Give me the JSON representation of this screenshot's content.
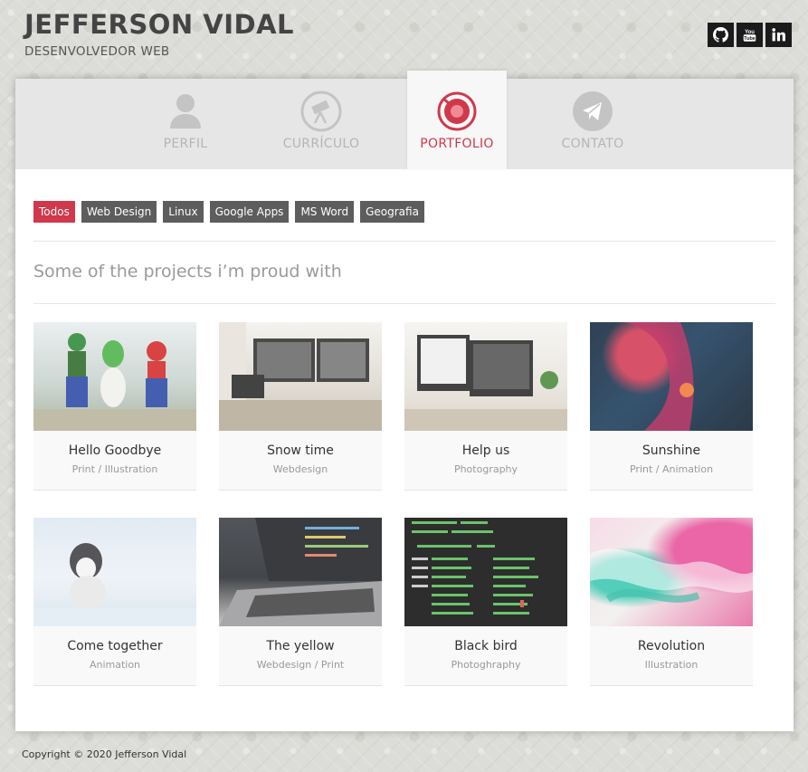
{
  "header": {
    "title": "JEFFERSON VIDAL",
    "subtitle": "DESENVOLVEDOR WEB",
    "social": [
      {
        "icon": "github-icon"
      },
      {
        "icon": "youtube-icon",
        "label": "You Tube"
      },
      {
        "icon": "linkedin-icon",
        "label": "in"
      }
    ]
  },
  "tabs": [
    {
      "label": "PERFIL",
      "icon": "user-icon",
      "active": false
    },
    {
      "label": "CURRÍCULO",
      "icon": "telescope-icon",
      "active": false
    },
    {
      "label": "PORTFOLIO",
      "icon": "target-icon",
      "active": true
    },
    {
      "label": "CONTATO",
      "icon": "paper-plane-icon",
      "active": false
    }
  ],
  "filters": [
    "Todos",
    "Web Design",
    "Linux",
    "Google Apps",
    "MS Word",
    "Geografia"
  ],
  "active_filter": "Todos",
  "section_heading": "Some of the projects i’m proud with",
  "projects": [
    {
      "title": "Hello Goodbye",
      "category": "Print / Illustration"
    },
    {
      "title": "Snow time",
      "category": "Webdesign"
    },
    {
      "title": "Help us",
      "category": "Photography"
    },
    {
      "title": "Sunshine",
      "category": "Print / Animation"
    },
    {
      "title": "Come together",
      "category": "Animation"
    },
    {
      "title": "The yellow",
      "category": "Webdesign / Print"
    },
    {
      "title": "Black bird",
      "category": "Photoghraphy"
    },
    {
      "title": "Revolution",
      "category": "Illustration"
    }
  ],
  "footer": "Copyright © 2020 Jefferson Vidal",
  "colors": {
    "accent": "#d0384b",
    "filter_bg": "#5d5d5d",
    "tab_inactive": "#b5b5b5"
  }
}
